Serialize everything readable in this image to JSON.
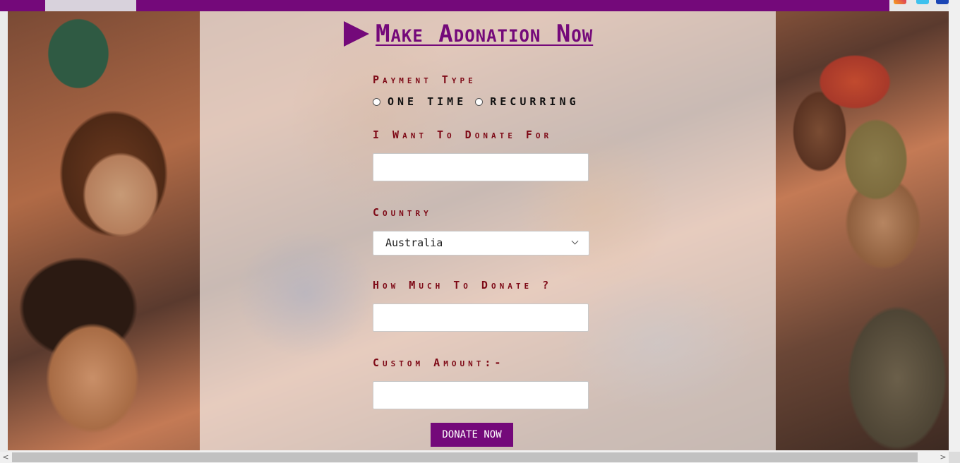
{
  "heading": "Make Adonation Now",
  "form": {
    "payment_type_label": "Payment Type",
    "radio_options": [
      "ONE TIME",
      "RECURRING"
    ],
    "donate_for_label": "I Want To Donate For",
    "donate_for_value": "",
    "country_label": "Country",
    "country_value": "Australia",
    "amount_label": "How Much To Donate ?",
    "amount_value": "",
    "custom_amount_label": "Custom Amount:-",
    "custom_amount_value": "",
    "submit_label": "DONATE NOW"
  },
  "colors": {
    "brand": "#74097a",
    "label": "#7e0a17"
  },
  "icons": {
    "heading": "play-arrow-icon",
    "select": "chevron-down-icon",
    "social": [
      "instagram-icon",
      "twitter-icon",
      "facebook-icon"
    ]
  },
  "scroll": {
    "left": "<",
    "right": ">"
  }
}
